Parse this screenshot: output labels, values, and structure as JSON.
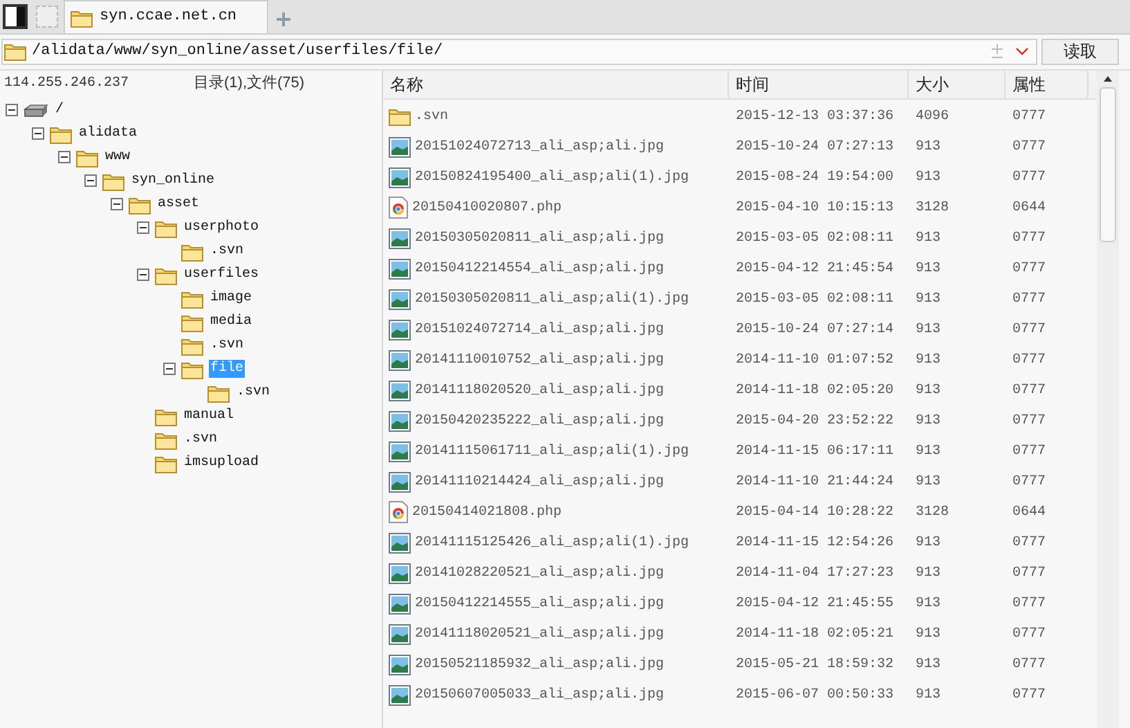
{
  "tabs": [
    {
      "label": "syn.ccae.net.cn",
      "selected": true
    }
  ],
  "address": {
    "value": "/alidata/www/syn_online/asset/userfiles/file/",
    "button": "读取"
  },
  "status": {
    "host": "114.255.246.237",
    "summary": "目录(1),文件(75)"
  },
  "tree": [
    {
      "label": "/",
      "kind": "drive",
      "expanded": true,
      "selected": false,
      "children": [
        {
          "label": "alidata",
          "kind": "folder",
          "expanded": true,
          "selected": false,
          "children": [
            {
              "label": "www",
              "kind": "folder",
              "expanded": true,
              "selected": false,
              "children": [
                {
                  "label": "syn_online",
                  "kind": "folder",
                  "expanded": true,
                  "selected": false,
                  "children": [
                    {
                      "label": "asset",
                      "kind": "folder",
                      "expanded": true,
                      "selected": false,
                      "children": [
                        {
                          "label": "userphoto",
                          "kind": "folder",
                          "expanded": true,
                          "selected": false,
                          "children": [
                            {
                              "label": ".svn",
                              "kind": "folder",
                              "selected": false
                            }
                          ]
                        },
                        {
                          "label": "userfiles",
                          "kind": "folder",
                          "expanded": true,
                          "selected": false,
                          "children": [
                            {
                              "label": "image",
                              "kind": "folder",
                              "selected": false
                            },
                            {
                              "label": "media",
                              "kind": "folder",
                              "selected": false
                            },
                            {
                              "label": ".svn",
                              "kind": "folder",
                              "selected": false
                            },
                            {
                              "label": "file",
                              "kind": "folder",
                              "expanded": true,
                              "selected": true,
                              "children": [
                                {
                                  "label": ".svn",
                                  "kind": "folder",
                                  "selected": false
                                }
                              ]
                            }
                          ]
                        },
                        {
                          "label": "manual",
                          "kind": "folder",
                          "selected": false
                        },
                        {
                          "label": ".svn",
                          "kind": "folder",
                          "selected": false
                        },
                        {
                          "label": "imsupload",
                          "kind": "folder",
                          "selected": false
                        }
                      ]
                    }
                  ]
                }
              ]
            }
          ]
        }
      ]
    }
  ],
  "table": {
    "columns": [
      "名称",
      "时间",
      "大小",
      "属性"
    ],
    "rows": [
      {
        "kind": "folder",
        "name": ".svn",
        "time": "2015-12-13 03:37:36",
        "size": "4096",
        "attr": "0777"
      },
      {
        "kind": "image",
        "name": "20151024072713_ali_asp;ali.jpg",
        "time": "2015-10-24 07:27:13",
        "size": "913",
        "attr": "0777"
      },
      {
        "kind": "image",
        "name": "20150824195400_ali_asp;ali(1).jpg",
        "time": "2015-08-24 19:54:00",
        "size": "913",
        "attr": "0777"
      },
      {
        "kind": "php",
        "name": "20150410020807.php",
        "time": "2015-04-10 10:15:13",
        "size": "3128",
        "attr": "0644"
      },
      {
        "kind": "image",
        "name": "20150305020811_ali_asp;ali.jpg",
        "time": "2015-03-05 02:08:11",
        "size": "913",
        "attr": "0777"
      },
      {
        "kind": "image",
        "name": "20150412214554_ali_asp;ali.jpg",
        "time": "2015-04-12 21:45:54",
        "size": "913",
        "attr": "0777"
      },
      {
        "kind": "image",
        "name": "20150305020811_ali_asp;ali(1).jpg",
        "time": "2015-03-05 02:08:11",
        "size": "913",
        "attr": "0777"
      },
      {
        "kind": "image",
        "name": "20151024072714_ali_asp;ali.jpg",
        "time": "2015-10-24 07:27:14",
        "size": "913",
        "attr": "0777"
      },
      {
        "kind": "image",
        "name": "20141110010752_ali_asp;ali.jpg",
        "time": "2014-11-10 01:07:52",
        "size": "913",
        "attr": "0777"
      },
      {
        "kind": "image",
        "name": "20141118020520_ali_asp;ali.jpg",
        "time": "2014-11-18 02:05:20",
        "size": "913",
        "attr": "0777"
      },
      {
        "kind": "image",
        "name": "20150420235222_ali_asp;ali.jpg",
        "time": "2015-04-20 23:52:22",
        "size": "913",
        "attr": "0777"
      },
      {
        "kind": "image",
        "name": "20141115061711_ali_asp;ali(1).jpg",
        "time": "2014-11-15 06:17:11",
        "size": "913",
        "attr": "0777"
      },
      {
        "kind": "image",
        "name": "20141110214424_ali_asp;ali.jpg",
        "time": "2014-11-10 21:44:24",
        "size": "913",
        "attr": "0777"
      },
      {
        "kind": "php",
        "name": "20150414021808.php",
        "time": "2015-04-14 10:28:22",
        "size": "3128",
        "attr": "0644"
      },
      {
        "kind": "image",
        "name": "20141115125426_ali_asp;ali(1).jpg",
        "time": "2014-11-15 12:54:26",
        "size": "913",
        "attr": "0777"
      },
      {
        "kind": "image",
        "name": "20141028220521_ali_asp;ali.jpg",
        "time": "2014-11-04 17:27:23",
        "size": "913",
        "attr": "0777"
      },
      {
        "kind": "image",
        "name": "20150412214555_ali_asp;ali.jpg",
        "time": "2015-04-12 21:45:55",
        "size": "913",
        "attr": "0777"
      },
      {
        "kind": "image",
        "name": "20141118020521_ali_asp;ali.jpg",
        "time": "2014-11-18 02:05:21",
        "size": "913",
        "attr": "0777"
      },
      {
        "kind": "image",
        "name": "20150521185932_ali_asp;ali.jpg",
        "time": "2015-05-21 18:59:32",
        "size": "913",
        "attr": "0777"
      },
      {
        "kind": "image",
        "name": "20150607005033_ali_asp;ali.jpg",
        "time": "2015-06-07 00:50:33",
        "size": "913",
        "attr": "0777"
      }
    ]
  }
}
